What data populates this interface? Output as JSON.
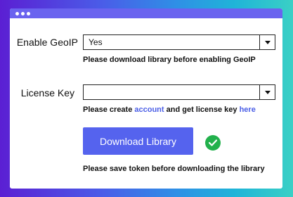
{
  "window": {
    "dots": 3
  },
  "geoip": {
    "label": "Enable GeoIP",
    "selected": "Yes",
    "help": "Please download library before enabling GeoIP"
  },
  "license": {
    "label": "License Key",
    "selected": "",
    "help_prefix": "Please create ",
    "help_link1": "account",
    "help_middle": " and get license key ",
    "help_link2": "here"
  },
  "download": {
    "button_label": "Download Library",
    "status_icon": "check-circle-icon",
    "note": "Please save token before downloading the library"
  },
  "colors": {
    "titlebar": "#6a63ef",
    "button": "#5563ee",
    "link": "#4a5ee6",
    "success": "#22b14c"
  }
}
